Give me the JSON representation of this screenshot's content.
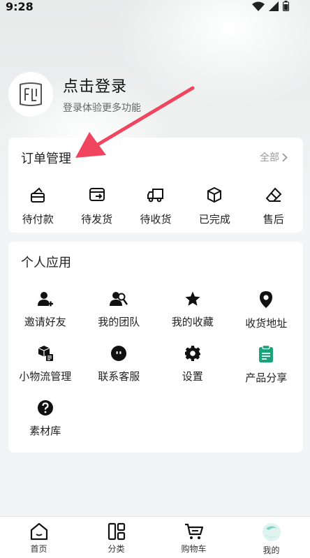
{
  "status": {
    "time": "9:28"
  },
  "profile": {
    "name": "点击登录",
    "subtitle": "登录体验更多功能"
  },
  "orders": {
    "title": "订单管理",
    "all_label": "全部",
    "items": [
      {
        "label": "待付款",
        "icon": "wallet-icon"
      },
      {
        "label": "待发货",
        "icon": "ship-box-icon"
      },
      {
        "label": "待收货",
        "icon": "truck-icon"
      },
      {
        "label": "已完成",
        "icon": "package-check-icon"
      },
      {
        "label": "售后",
        "icon": "eraser-icon"
      }
    ]
  },
  "apps": {
    "title": "个人应用",
    "items": [
      {
        "label": "邀请好友",
        "icon": "add-user-icon"
      },
      {
        "label": "我的团队",
        "icon": "team-icon"
      },
      {
        "label": "我的收藏",
        "icon": "star-icon"
      },
      {
        "label": "收货地址",
        "icon": "location-pin-icon"
      },
      {
        "label": "小物流管理",
        "icon": "logistics-box-icon"
      },
      {
        "label": "联系客服",
        "icon": "service-face-icon"
      },
      {
        "label": "设置",
        "icon": "gear-icon"
      },
      {
        "label": "产品分享",
        "icon": "clipboard-icon",
        "color": "#1aa37a"
      },
      {
        "label": "素材库",
        "icon": "question-icon"
      }
    ]
  },
  "tabbar": {
    "items": [
      {
        "label": "首页",
        "icon": "home-icon"
      },
      {
        "label": "分类",
        "icon": "category-icon"
      },
      {
        "label": "购物车",
        "icon": "cart-icon"
      },
      {
        "label": "我的",
        "icon": "me-icon",
        "active": true
      }
    ]
  },
  "colors": {
    "annotation_arrow": "#f0455e",
    "accent_green": "#1aa37a"
  }
}
